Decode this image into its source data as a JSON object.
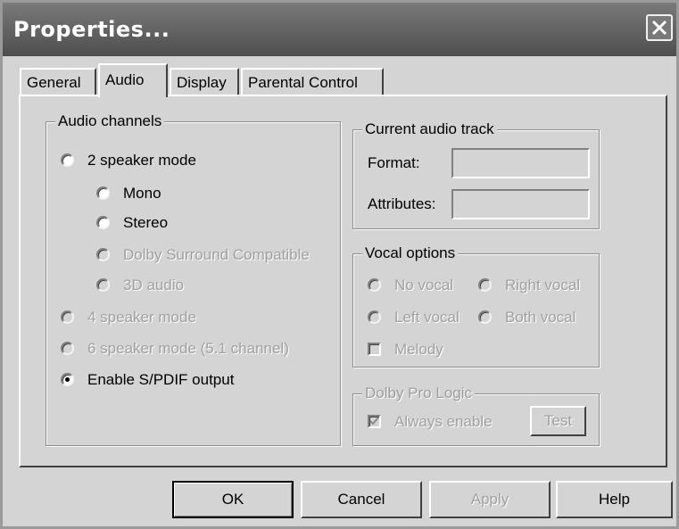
{
  "window": {
    "title": "Properties..."
  },
  "tabs": [
    {
      "label": "General",
      "active": false
    },
    {
      "label": "Audio",
      "active": true
    },
    {
      "label": "Display",
      "active": false
    },
    {
      "label": "Parental Control",
      "active": false
    }
  ],
  "audio_channels": {
    "legend": "Audio channels",
    "options": [
      {
        "label": "2 speaker mode",
        "enabled": true,
        "selected": false
      },
      {
        "label": "Mono",
        "enabled": true,
        "selected": false
      },
      {
        "label": "Stereo",
        "enabled": true,
        "selected": false
      },
      {
        "label": "Dolby Surround Compatible",
        "enabled": false,
        "selected": false
      },
      {
        "label": "3D audio",
        "enabled": false,
        "selected": false
      },
      {
        "label": "4 speaker mode",
        "enabled": false,
        "selected": false
      },
      {
        "label": "6 speaker mode (5.1 channel)",
        "enabled": false,
        "selected": false
      },
      {
        "label": "Enable S/PDIF output",
        "enabled": true,
        "selected": true
      }
    ]
  },
  "current_audio_track": {
    "legend": "Current audio track",
    "format_label": "Format:",
    "format_value": "",
    "attributes_label": "Attributes:",
    "attributes_value": ""
  },
  "vocal_options": {
    "legend": "Vocal options",
    "no_vocal": "No vocal",
    "right_vocal": "Right vocal",
    "left_vocal": "Left vocal",
    "both_vocal": "Both vocal",
    "melody": "Melody"
  },
  "dolby_pro_logic": {
    "legend": "Dolby Pro Logic",
    "always_enable": "Always enable",
    "always_enable_checked": true,
    "test_label": "Test"
  },
  "buttons": {
    "ok": "OK",
    "cancel": "Cancel",
    "apply": "Apply",
    "help": "Help"
  },
  "colors": {
    "titlebar": "#5a5a5a",
    "face": "#d4d4d4",
    "disabled_text": "#a0a0a0"
  }
}
